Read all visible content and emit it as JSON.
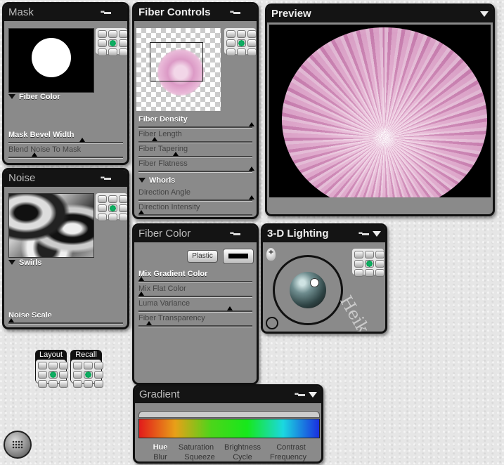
{
  "mask": {
    "title": "Mask",
    "section": "Fiber Color",
    "sliders": [
      {
        "label": "Mask Bevel Width",
        "value": 0.62,
        "active": true
      },
      {
        "label": "Blend Noise To Mask",
        "value": 0.2,
        "active": false
      }
    ]
  },
  "noise": {
    "title": "Noise",
    "section": "Swirls",
    "sliders": [
      {
        "label": "Noise Scale",
        "value": 0.0,
        "active": true
      }
    ]
  },
  "fiber_controls": {
    "title": "Fiber Controls",
    "sliders": [
      {
        "label": "Fiber Density",
        "value": 0.98,
        "active": true
      },
      {
        "label": "Fiber Length",
        "value": 0.12,
        "active": false
      },
      {
        "label": "Fiber Tapering",
        "value": 0.3,
        "active": false
      },
      {
        "label": "Fiber Flatness",
        "value": 0.98,
        "active": false
      }
    ],
    "section": "Whorls",
    "section_sliders": [
      {
        "label": "Direction Angle",
        "value": 0.98,
        "active": false
      },
      {
        "label": "Direction Intensity",
        "value": 0.0,
        "active": false
      }
    ]
  },
  "preview": {
    "title": "Preview"
  },
  "fiber_color": {
    "title": "Fiber Color",
    "plastic_label": "Plastic",
    "sliders": [
      {
        "label": "Mix Gradient Color",
        "value": 0.0,
        "active": true
      },
      {
        "label": "Mix Flat Color",
        "value": 0.0,
        "active": false
      },
      {
        "label": "Luma Variance",
        "value": 0.78,
        "active": false
      },
      {
        "label": "Fiber Transparency",
        "value": 0.07,
        "active": false
      }
    ]
  },
  "lighting": {
    "title": "3-D Lighting",
    "watermark": "Heike"
  },
  "gradient": {
    "title": "Gradient",
    "colors": [
      "#e21b1b",
      "#e8a018",
      "#4cd51a",
      "#17e81b",
      "#1bd8e0",
      "#1a2fe0"
    ],
    "labels_top": [
      "Hue",
      "Saturation",
      "Brightness",
      "Contrast"
    ],
    "labels_bottom": [
      "Blur",
      "Squeeze",
      "Cycle",
      "Frequency"
    ]
  },
  "buttons": {
    "layout": "Layout",
    "recall": "Recall"
  }
}
